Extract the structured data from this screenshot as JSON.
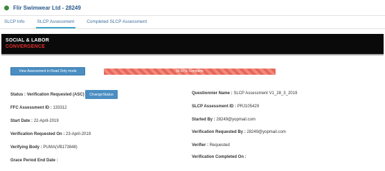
{
  "header": {
    "company": "Flir Swimwear Ltd - 28249",
    "status_color": "#3a8a3a"
  },
  "tabs": [
    {
      "label": "SLCP Info",
      "active": false
    },
    {
      "label": "SLCP Assessment",
      "active": true
    },
    {
      "label": "Completed SLCP Assessment",
      "active": false
    }
  ],
  "banner": {
    "line1": "SOCIAL & LABOR",
    "line2": "CONVERGENCE"
  },
  "actions": {
    "readonly_label": "View Assessment in Read Only mode",
    "change_status_label": "ChangeStatus"
  },
  "progress": {
    "label": "96.67% Complete",
    "percent": 96.67,
    "color": "#e8665a"
  },
  "left_fields": {
    "status": {
      "label": "Status :",
      "value": "Verification Requested (ASC)"
    },
    "ffc_id": {
      "label": "FFC Assessment ID :",
      "value": "133312"
    },
    "start_date": {
      "label": "Start Date :",
      "value": "22-April-2019"
    },
    "verification_requested_on": {
      "label": "Verification Requested On :",
      "value": "23-April-2019"
    },
    "verifying_body": {
      "label": "Verifying Body :",
      "value": "PUMA(VB173848)"
    },
    "grace_period_end": {
      "label": "Grace Period End Date :",
      "value": ""
    }
  },
  "right_fields": {
    "questionnaire": {
      "label": "Questionnier Name :",
      "value": "SLCP Assessment V1_28_3_2019"
    },
    "slcp_id": {
      "label": "SLCP Assessment ID :",
      "value": "PRJ105429"
    },
    "started_by": {
      "label": "Started By :",
      "value": "28249@yopmail.com"
    },
    "verification_requested_by": {
      "label": "Verification Requested By :",
      "value": "28249@yopmail.com"
    },
    "verifier": {
      "label": "Verifier :",
      "value": "Requested"
    },
    "verification_completed_on": {
      "label": "Verification Completed On :",
      "value": ""
    }
  }
}
